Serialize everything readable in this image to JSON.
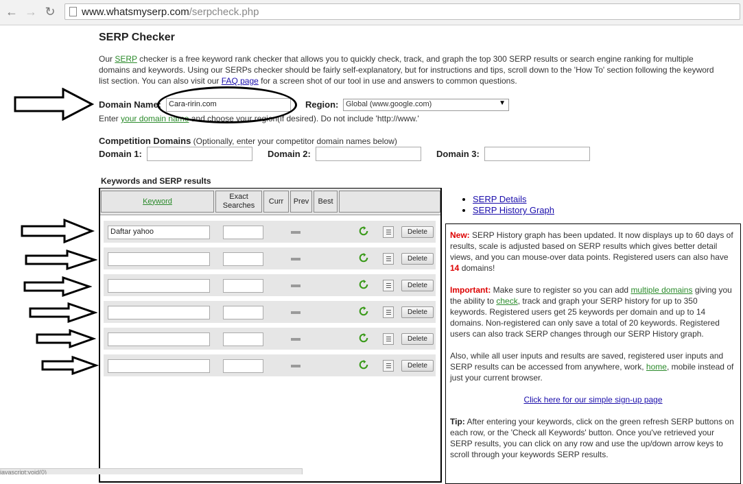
{
  "browser": {
    "url_domain": "www.whatsmyserp.com",
    "url_path": "/serpcheck.php"
  },
  "page": {
    "title": "SERP Checker",
    "intro_pre": "Our ",
    "intro_link_serp": "SERP",
    "intro_mid": " checker is a free keyword rank checker that allows you to quickly check, track, and graph the top 300 SERP results or search engine ranking for multiple domains and keywords. Using our SERPs checker should be fairly self-explanatory, but for instructions and tips, scroll down to the 'How To' section following the keyword list section. You can also visit our ",
    "intro_link_faq": "FAQ page",
    "intro_post": " for a screen shot of our tool in use and answers to common questions."
  },
  "domain": {
    "label": "Domain Name:",
    "value": "Cara-ririn.com",
    "region_label": "Region:",
    "region_value": "Global (www.google.com)",
    "hint_pre": "Enter ",
    "hint_link": "your domain name",
    "hint_post": " and choose your region(if desired). Do not include 'http://www.'"
  },
  "competition": {
    "heading": "Competition Domains",
    "note": " (Optionally, enter your competitor domain names below)",
    "d1_label": "Domain 1:",
    "d2_label": "Domain 2:",
    "d3_label": "Domain 3:"
  },
  "keywords": {
    "heading": "Keywords and SERP results",
    "col_keyword": "Keyword",
    "col_exact": "Exact Searches",
    "col_curr": "Curr",
    "col_prev": "Prev",
    "col_best": "Best",
    "delete_label": "Delete",
    "rows": [
      "Daftar yahoo",
      "",
      "",
      "",
      "",
      ""
    ]
  },
  "side_links": {
    "details": "SERP Details",
    "history": "SERP History Graph"
  },
  "info": {
    "new_label": "New:",
    "new_text_pre": " SERP History graph has been updated. It now displays up to 60 days of results, scale is adjusted based on SERP results which gives better detail views, and you can mouse-over data points. Registered users can also have ",
    "new_num": "14",
    "new_text_post": " domains!",
    "imp_label": "Important:",
    "imp_pre": " Make sure to register so you can add ",
    "imp_link1": "multiple domains",
    "imp_mid1": " giving you the ability to ",
    "imp_link2": "check",
    "imp_post": ", track and graph your SERP history for up to 350 keywords. Registered users get 25 keywords per domain and up to 14 domains. Non-registered can only save a total of 20 keywords. Registered users can also track SERP changes through our SERP History graph.",
    "also_pre": "Also, while all user inputs and results are saved, registered user inputs and SERP results can be accessed from anywhere, work, ",
    "also_link": "home",
    "also_post": ", mobile instead of just your current browser.",
    "signup_link": "Click here for our simple sign-up page",
    "tip_label": "Tip:",
    "tip_text": " After entering your keywords, click on the green refresh SERP buttons on each row, or the 'Check all Keywords' button. Once you've retrieved your SERP results, you can click on any row and use the up/down arrow keys to scroll through your keywords SERP results."
  },
  "status_bar": "javascript:void(0)"
}
